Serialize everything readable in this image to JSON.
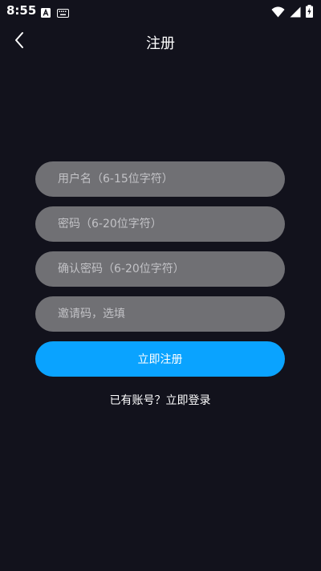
{
  "status_bar": {
    "time": "8:55",
    "icons": [
      "app-a-icon",
      "keyboard-icon",
      "wifi-icon",
      "signal-icon",
      "battery-charging-icon"
    ]
  },
  "header": {
    "title": "注册",
    "back_icon": "chevron-left-icon"
  },
  "form": {
    "username": {
      "placeholder": "用户名（6-15位字符）",
      "value": ""
    },
    "password": {
      "placeholder": "密码（6-20位字符）",
      "value": ""
    },
    "confirm_password": {
      "placeholder": "确认密码（6-20位字符）",
      "value": ""
    },
    "invite_code": {
      "placeholder": "邀请码，选填",
      "value": ""
    },
    "submit_label": "立即注册"
  },
  "login_prompt": {
    "question": "已有账号？",
    "link_label": "立即登录"
  },
  "colors": {
    "background": "#12121c",
    "field": "#707074",
    "accent": "#0aa3ff",
    "text": "#ffffff"
  }
}
